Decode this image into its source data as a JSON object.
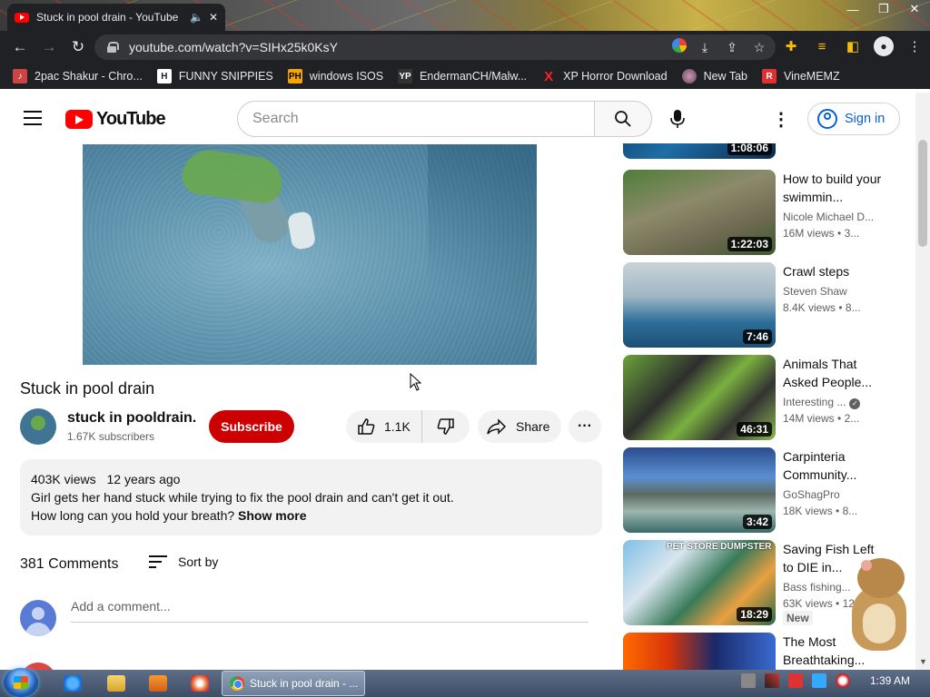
{
  "browser": {
    "tab_title": "Stuck in pool drain - YouTube",
    "url": "youtube.com/watch?v=SIHx25k0KsY",
    "bookmarks": [
      {
        "label": "2pac Shakur - Chro...",
        "icon": "music-icon",
        "color": "#ffffff"
      },
      {
        "label": "FUNNY SNIPPIES",
        "icon": "H",
        "color": "#ffffff"
      },
      {
        "label": "windows ISOS",
        "icon": "PH",
        "color": "#f7a400"
      },
      {
        "label": "EndermanCH/Malw...",
        "icon": "YP",
        "color": "#ffffff"
      },
      {
        "label": "XP Horror Download",
        "icon": "X",
        "color": "#ff2020"
      },
      {
        "label": "New Tab",
        "icon": "globe-icon",
        "color": "#ffffff"
      },
      {
        "label": "VineMEMZ",
        "icon": "R",
        "color": "#e03030"
      }
    ]
  },
  "header": {
    "logo_text": "YouTube",
    "search_placeholder": "Search",
    "signin_label": "Sign in"
  },
  "video": {
    "title": "Stuck in pool drain",
    "channel_name": "stuck in pooldrain.",
    "subscribers": "1.67K subscribers",
    "subscribe_label": "Subscribe",
    "likes": "1.1K",
    "share_label": "Share",
    "views": "403K views",
    "age": "12 years ago",
    "description_line1": "Girl gets her hand stuck while trying to fix the pool drain and can't get it out.",
    "description_line2": "How long can you hold your breath?",
    "show_more": "Show more"
  },
  "comments": {
    "count": "381 Comments",
    "sort_label": "Sort by",
    "placeholder": "Add a comment..."
  },
  "recommendations": [
    {
      "title": "",
      "channel": "",
      "views": "",
      "duration": "1:08:06",
      "thumb": "linear-gradient(135deg,#0b2a4a,#1e6ea8 50%,#0b2a4a)"
    },
    {
      "title": "How to build your swimmin...",
      "channel": "Nicole Michael D...",
      "views": "16M views",
      "age": "3...",
      "duration": "1:22:03",
      "thumb": "linear-gradient(160deg,#4f7d3a 0%,#8d8a6a 40%,#6e6a52 70%,#3f5a2e 100%)"
    },
    {
      "title": "Crawl steps",
      "channel": "Steven Shaw",
      "views": "8.4K views",
      "age": "8...",
      "duration": "7:46",
      "thumb": "linear-gradient(180deg,#c9d3d8 0%,#9fb6c4 40%,#2d6f9a 70%,#1c4f75 100%)"
    },
    {
      "title": "Animals That Asked People...",
      "channel": "Interesting ...",
      "verified": true,
      "views": "14M views",
      "age": "2...",
      "duration": "46:31",
      "thumb": "linear-gradient(135deg,#6aa33a 0%,#2e2e2e 35%,#7ab03f 55%,#333 75%,#8ab850 100%)"
    },
    {
      "title": "Carpinteria Community...",
      "channel": "GoShagPro",
      "views": "18K views",
      "age": "8...",
      "duration": "3:42",
      "thumb": "linear-gradient(180deg,#2a4d8f 0%,#5b8fd1 35%,#5d6a63 55%,#9cb6ae 75%,#3a6a6a 100%)"
    },
    {
      "title": "Saving Fish Left to DIE in...",
      "channel": "Bass fishing...",
      "views": "63K views",
      "age": "12...",
      "duration": "18:29",
      "badge": "New",
      "thumb": "linear-gradient(135deg,#7fbfe6 0%,#d8e6ee 30%,#3a7a5a 55%,#e8a040 75%,#2a6a4a 100%)",
      "thumb_text": "PET STORE DUMPSTER"
    },
    {
      "title": "The Most Breathtaking...",
      "channel": "",
      "views": "",
      "duration": "",
      "thumb": "linear-gradient(90deg,#ff6a00 0%,#d9340a 30%,#1a2a6a 60%,#3a6ad0 100%)"
    }
  ],
  "taskbar": {
    "task_label": "Stuck in pool drain - ...",
    "clock": "1:39 AM"
  },
  "colors": {
    "youtube_red": "#ff0000",
    "subscribe_red": "#cc0000",
    "link_blue": "#065fd4",
    "chrome_dark": "#202124"
  }
}
